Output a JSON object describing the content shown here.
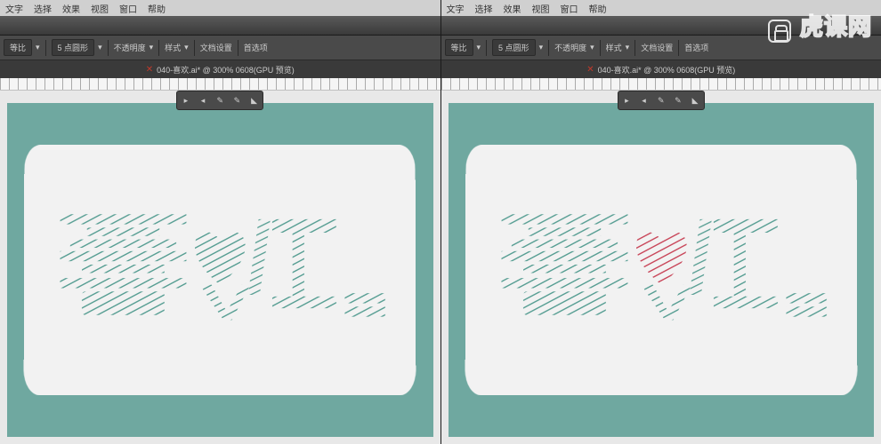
{
  "menu": {
    "items": [
      "文字",
      "选择",
      "效果",
      "视图",
      "窗口",
      "帮助"
    ]
  },
  "controlbar": {
    "btn1": "等比",
    "btn2": "5 点圆形",
    "lbl_opacity": "不透明度",
    "lbl_style": "样式",
    "lbl_docsetup": "文档设置",
    "lbl_prefs": "首选项"
  },
  "tab": {
    "left": "040-喜欢.ai* @ 300% 0608(GPU 预览)",
    "right": "040-喜欢.ai* @ 300% 0608(GPU 预览)"
  },
  "toolbar_icons": [
    "▸",
    "◂",
    "✎",
    "✎",
    "◣"
  ],
  "watermark": "虎课网",
  "artwork": {
    "text": "喜欢",
    "heart_color_left": "#579e93",
    "heart_color_right": "#c9485b",
    "stroke_color": "#579e93"
  },
  "canvas_bg": "#6fa8a0",
  "card_bg": "#f2f2f2"
}
